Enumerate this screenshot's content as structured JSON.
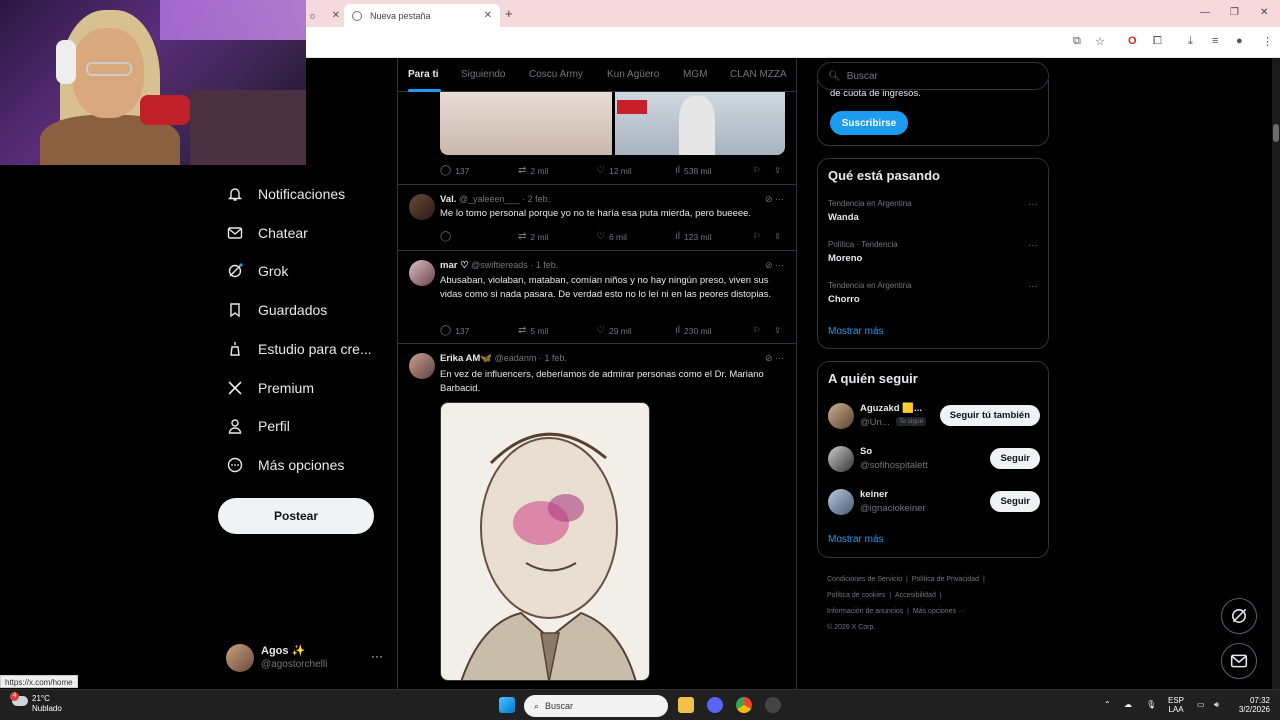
{
  "browser": {
    "tabs": [
      {
        "label": "o"
      },
      {
        "label": "Nueva pestaña"
      }
    ],
    "new_tab_icon": "plus-icon",
    "status_url": "https://x.com/home"
  },
  "feed_tabs": [
    "Para ti",
    "Siguiendo",
    "Coscu Army",
    "Kun Agüero",
    "MGM",
    "CLAN MZZA"
  ],
  "nav": {
    "items": [
      {
        "label": "Notificaciones",
        "icon": "bell-icon"
      },
      {
        "label": "Chatear",
        "icon": "mail-icon"
      },
      {
        "label": "Grok",
        "icon": "grok-icon"
      },
      {
        "label": "Guardados",
        "icon": "bookmark-icon"
      },
      {
        "label": "Estudio para cre...",
        "icon": "studio-icon"
      },
      {
        "label": "Premium",
        "icon": "x-logo-icon"
      },
      {
        "label": "Perfil",
        "icon": "person-icon"
      },
      {
        "label": "Más opciones",
        "icon": "more-circle-icon"
      }
    ],
    "post_label": "Postear",
    "account": {
      "name": "Agos ✨",
      "handle": "@agostorchelli",
      "more": "···"
    }
  },
  "posts": [
    {
      "stats": {
        "replies": "137",
        "reposts": "2 mil",
        "likes": "12 mil",
        "views": "538 mil"
      }
    },
    {
      "name": "Val.",
      "handle": "@_yaleeen___",
      "date": "· 2 feb.",
      "text": "Me lo tomo personal porque yo no te haría esa puta mierda, pero bueeee.",
      "stats": {
        "replies": "",
        "reposts": "2 mil",
        "likes": "6 mil",
        "views": "123 mil"
      }
    },
    {
      "name": "mar ♡",
      "handle": "@swiftiereads",
      "date": "· 1 feb.",
      "text": "Abusaban, violaban, mataban, comían niños y no hay ningún preso, viven sus vidas como si nada pasara. De verdad esto no lo leí ni en las peores distopias.",
      "stats": {
        "replies": "137",
        "reposts": "5 mil",
        "likes": "29 mil",
        "views": "230 mil"
      }
    },
    {
      "name": "Erika AM🦋",
      "handle": "@eadanm",
      "date": "· 1 feb.",
      "text": "En vez de influencers, deberíamos de admirar personas como el Dr. Mariano Barbacid."
    }
  ],
  "right": {
    "search_placeholder": "Buscar",
    "premium_text": "de cuota de ingresos.",
    "subscribe_label": "Suscribirse",
    "trends_title": "Qué está pasando",
    "trends": [
      {
        "context": "Tendencia en Argentina",
        "name": "Wanda"
      },
      {
        "context": "Política · Tendencia",
        "name": "Moreno"
      },
      {
        "context": "Tendencia en Argentina",
        "name": "Chorro"
      }
    ],
    "show_more": "Mostrar más",
    "follow_title": "A quién seguir",
    "follow": [
      {
        "name": "Aguzakd 🟨...",
        "handle": "@Un...",
        "badge": "Te sigue",
        "button": "Seguir tú también"
      },
      {
        "name": "So",
        "handle": "@sofihospitalett",
        "badge": "",
        "button": "Seguir"
      },
      {
        "name": "keiner",
        "handle": "@ignaciokeiner",
        "badge": "",
        "button": "Seguir"
      }
    ],
    "footer": [
      "Condiciones de Servicio",
      "|",
      "Política de Privacidad",
      "|",
      "Política de cookies",
      "|",
      "Accesibilidad",
      "|",
      "Información de anuncios",
      "|",
      "Más opciones ···",
      "© 2026 X Corp."
    ]
  },
  "taskbar": {
    "weather_temp": "21°C",
    "weather_desc": "Nublado",
    "weather_badge": "4",
    "search": "Buscar",
    "lang1": "ESP",
    "lang2": "LAA",
    "time": "07:32",
    "date": "3/2/2026"
  },
  "colors": {
    "accent": "#1d9bf0",
    "bg": "#000000",
    "border": "#2f3336",
    "muted": "#71767b",
    "tab_strip": "#f6d9dd"
  }
}
